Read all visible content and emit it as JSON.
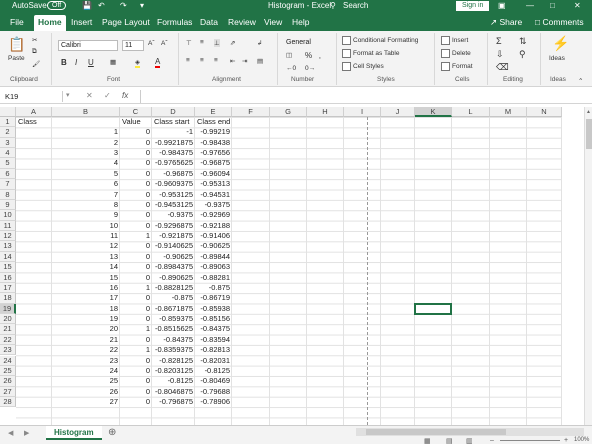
{
  "titlebar": {
    "autosave_label": "AutoSave",
    "autosave_state": "Off",
    "title": "Histogram  -  Excel",
    "search_placeholder": "Search",
    "signin_label": "Sign in"
  },
  "tabs": [
    "File",
    "Home",
    "Insert",
    "Page Layout",
    "Formulas",
    "Data",
    "Review",
    "View",
    "Help"
  ],
  "share_label": "Share",
  "comments_label": "Comments",
  "ribbon": {
    "clipboard": {
      "paste": "Paste",
      "label": "Clipboard"
    },
    "font": {
      "name": "Calibri",
      "size": "11",
      "label": "Font"
    },
    "alignment": {
      "label": "Alignment"
    },
    "number": {
      "format": "General",
      "label": "Number"
    },
    "styles": {
      "cond": "Conditional Formatting",
      "table": "Format as Table",
      "cell": "Cell Styles",
      "label": "Styles"
    },
    "cells": {
      "insert": "Insert",
      "delete": "Delete",
      "format": "Format",
      "label": "Cells"
    },
    "editing": {
      "label": "Editing"
    },
    "ideas": {
      "btn": "Ideas",
      "label": "Ideas"
    }
  },
  "formula_bar": {
    "name_box": "K19",
    "fx": "fx",
    "content": ""
  },
  "columns": [
    "A",
    "B",
    "C",
    "D",
    "E",
    "F",
    "G",
    "H",
    "I",
    "J",
    "K",
    "L",
    "M",
    "N"
  ],
  "headers": [
    "Class",
    "Value",
    "Class start",
    "Class end"
  ],
  "rows": [
    [
      1,
      0,
      "-1",
      "-0.99219"
    ],
    [
      2,
      0,
      "-0.9921875",
      "-0.98438"
    ],
    [
      3,
      0,
      "-0.984375",
      "-0.97656"
    ],
    [
      4,
      0,
      "-0.9765625",
      "-0.96875"
    ],
    [
      5,
      0,
      "-0.96875",
      "-0.96094"
    ],
    [
      6,
      0,
      "-0.9609375",
      "-0.95313"
    ],
    [
      7,
      0,
      "-0.953125",
      "-0.94531"
    ],
    [
      8,
      0,
      "-0.9453125",
      "-0.9375"
    ],
    [
      9,
      0,
      "-0.9375",
      "-0.92969"
    ],
    [
      10,
      0,
      "-0.9296875",
      "-0.92188"
    ],
    [
      11,
      1,
      "-0.921875",
      "-0.91406"
    ],
    [
      12,
      0,
      "-0.9140625",
      "-0.90625"
    ],
    [
      13,
      0,
      "-0.90625",
      "-0.89844"
    ],
    [
      14,
      0,
      "-0.8984375",
      "-0.89063"
    ],
    [
      15,
      0,
      "-0.890625",
      "-0.88281"
    ],
    [
      16,
      1,
      "-0.8828125",
      "-0.875"
    ],
    [
      17,
      0,
      "-0.875",
      "-0.86719"
    ],
    [
      18,
      0,
      "-0.8671875",
      "-0.85938"
    ],
    [
      19,
      0,
      "-0.859375",
      "-0.85156"
    ],
    [
      20,
      1,
      "-0.8515625",
      "-0.84375"
    ],
    [
      21,
      0,
      "-0.84375",
      "-0.83594"
    ],
    [
      22,
      1,
      "-0.8359375",
      "-0.82813"
    ],
    [
      23,
      0,
      "-0.828125",
      "-0.82031"
    ],
    [
      24,
      0,
      "-0.8203125",
      "-0.8125"
    ],
    [
      25,
      0,
      "-0.8125",
      "-0.80469"
    ],
    [
      26,
      0,
      "-0.8046875",
      "-0.79688"
    ],
    [
      27,
      0,
      "-0.796875",
      "-0.78906"
    ]
  ],
  "row_numbers": [
    "1",
    "2",
    "3",
    "4",
    "5",
    "6",
    "7",
    "8",
    "9",
    "10",
    "11",
    "12",
    "13",
    "14",
    "15",
    "16",
    "17",
    "18",
    "19",
    "20",
    "21",
    "22",
    "23",
    "24",
    "25",
    "26",
    "27",
    "28"
  ],
  "selected_cell": "K19",
  "sheet_tab": "Histogram",
  "status": {
    "zoom": "100%"
  },
  "colors": {
    "brand": "#217346",
    "selection": "#217346"
  }
}
